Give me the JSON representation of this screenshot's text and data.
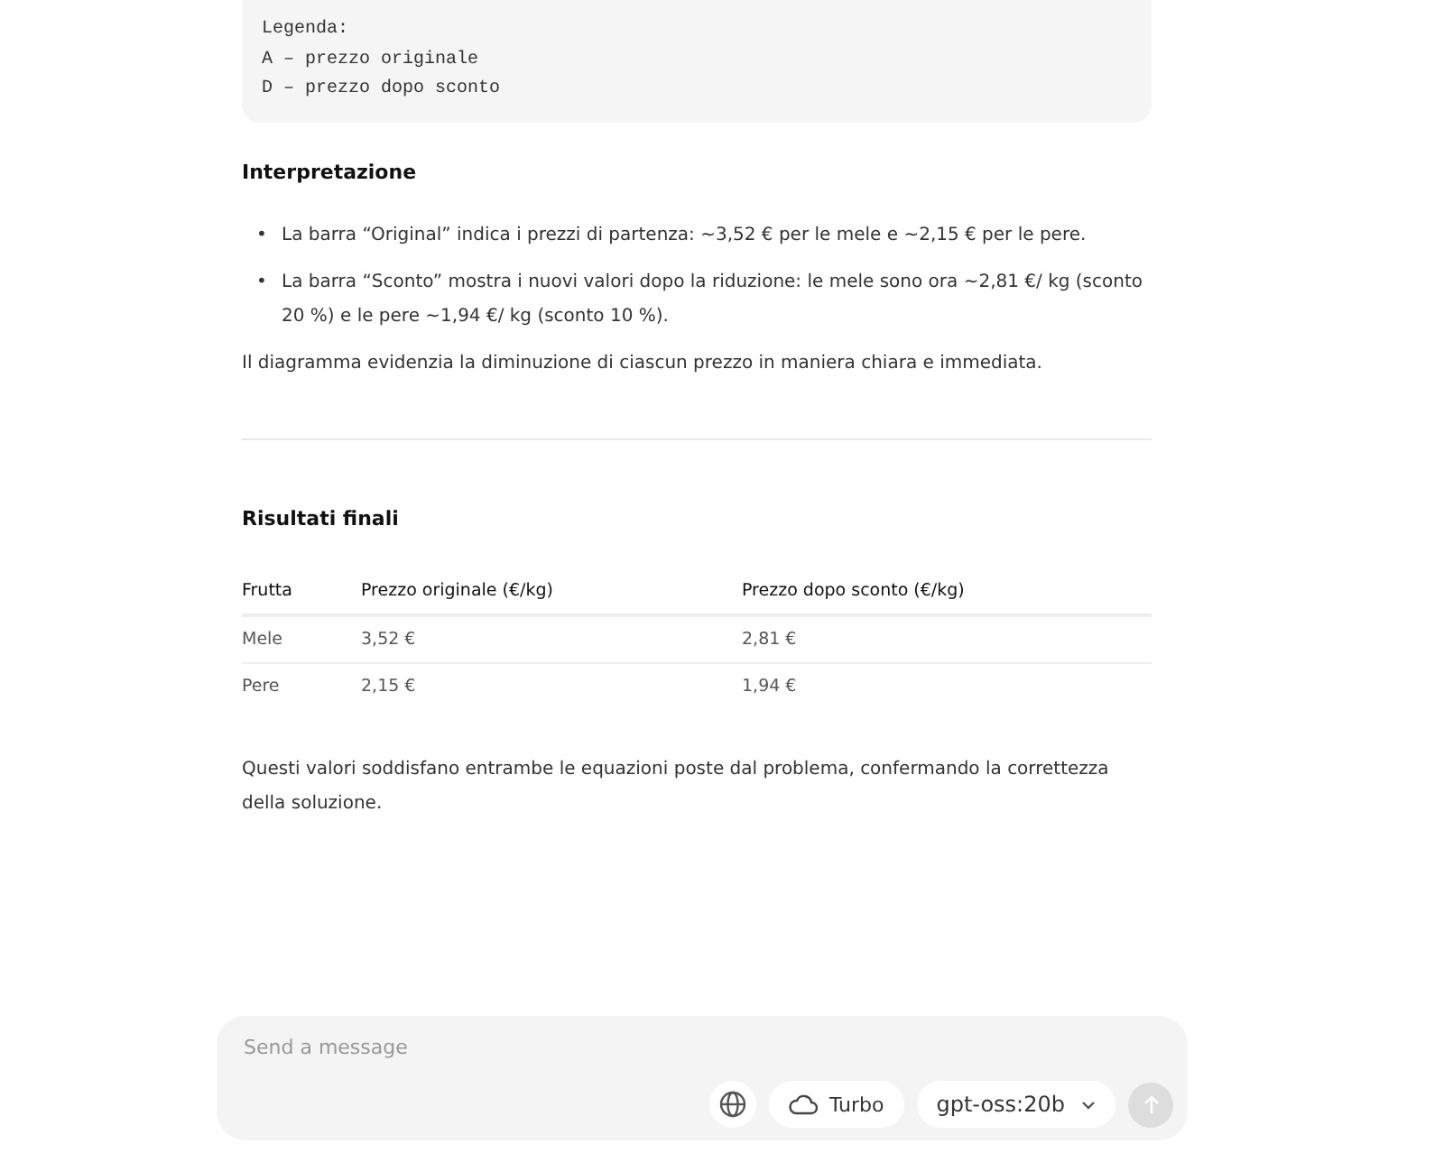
{
  "code_block": {
    "lines": [
      "Legenda:",
      "A – prezzo originale",
      "D – prezzo dopo sconto"
    ]
  },
  "interpretation": {
    "heading": "Interpretazione",
    "bullets": [
      {
        "marker": "•",
        "text": "La barra “Original” indica i prezzi di partenza: ~3,52 € per le mele e ~2,15 € per le pere."
      },
      {
        "marker": "•",
        "text": "La barra “Sconto” mostra i nuovi valori dopo la riduzione: le mele sono ora ~2,81 €/ kg (sconto 20 %) e le pere ~1,94 €/ kg (sconto 10 %)."
      }
    ],
    "paragraph": "Il diagramma evidenzia la diminuzione di ciascun prezzo in maniera chiara e immediata."
  },
  "results": {
    "heading": "Risultati finali",
    "table": {
      "columns": [
        "Frutta",
        "Prezzo originale (€/kg)",
        "Prezzo dopo sconto (€/kg)"
      ],
      "rows": [
        [
          "Mele",
          "3,52 €",
          "2,81 €"
        ],
        [
          "Pere",
          "2,15 €",
          "1,94 €"
        ]
      ]
    },
    "paragraph": "Questi valori soddisfano entrambe le equazioni poste dal problema, confermando la correttezza della soluzione."
  },
  "composer": {
    "placeholder": "Send a message",
    "turbo_label": "Turbo",
    "model": "gpt-oss:20b",
    "send_disabled": true
  }
}
